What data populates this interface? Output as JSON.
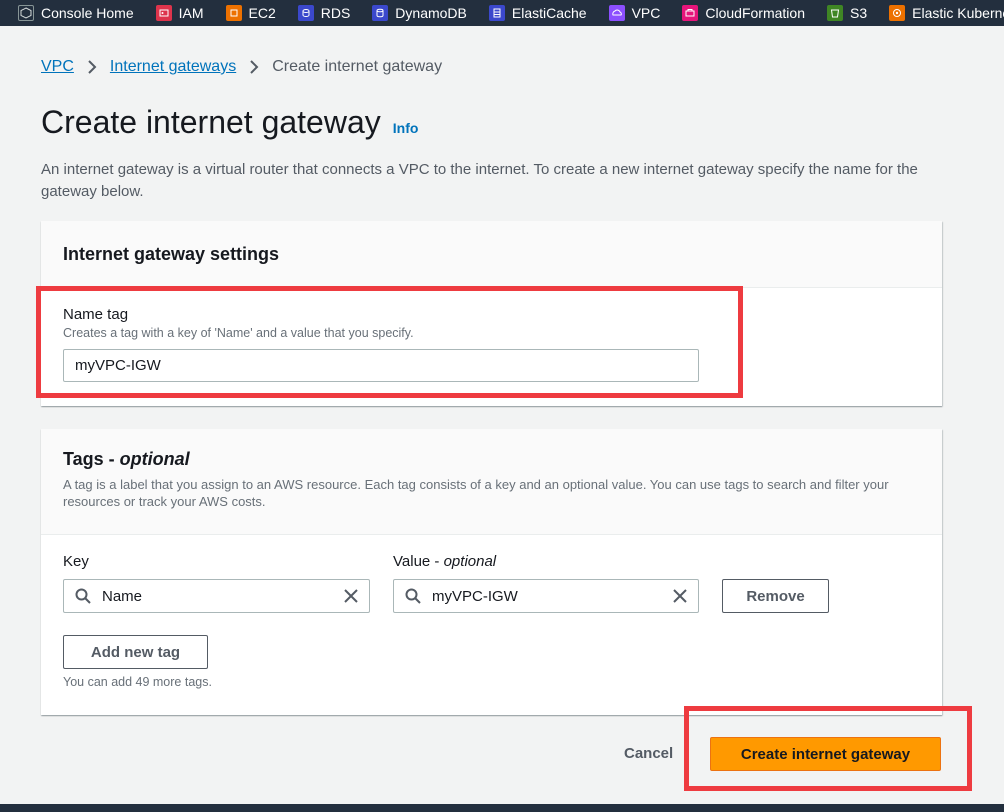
{
  "services": [
    {
      "label": "Console Home",
      "icon": "console-home-icon",
      "color": "#232f3e"
    },
    {
      "label": "IAM",
      "icon": "iam-icon",
      "color": "#dd344c"
    },
    {
      "label": "EC2",
      "icon": "ec2-icon",
      "color": "#ed7100"
    },
    {
      "label": "RDS",
      "icon": "rds-icon",
      "color": "#3b48cc"
    },
    {
      "label": "DynamoDB",
      "icon": "dynamodb-icon",
      "color": "#3b48cc"
    },
    {
      "label": "ElastiCache",
      "icon": "elasticache-icon",
      "color": "#3b48cc"
    },
    {
      "label": "VPC",
      "icon": "vpc-icon",
      "color": "#8c4fff"
    },
    {
      "label": "CloudFormation",
      "icon": "cloudformation-icon",
      "color": "#e7157b"
    },
    {
      "label": "S3",
      "icon": "s3-icon",
      "color": "#3f8624"
    },
    {
      "label": "Elastic Kubernetes Se",
      "icon": "eks-icon",
      "color": "#ed7100"
    }
  ],
  "breadcrumb": {
    "vpc": "VPC",
    "internet_gateways": "Internet gateways",
    "current": "Create internet gateway"
  },
  "page": {
    "title": "Create internet gateway",
    "info": "Info",
    "description": "An internet gateway is a virtual router that connects a VPC to the internet. To create a new internet gateway specify the name for the gateway below."
  },
  "settings": {
    "title": "Internet gateway settings",
    "name_tag_label": "Name tag",
    "name_tag_desc": "Creates a tag with a key of 'Name' and a value that you specify.",
    "name_tag_value": "myVPC-IGW"
  },
  "tags": {
    "title": "Tags - ",
    "title_optional": "optional",
    "description": "A tag is a label that you assign to an AWS resource. Each tag consists of a key and an optional value. You can use tags to search and filter your resources or track your AWS costs.",
    "key_label": "Key",
    "value_label": "Value - ",
    "value_optional": "optional",
    "key_value": "Name",
    "value_value": "myVPC-IGW",
    "remove": "Remove",
    "add_new_tag": "Add new tag",
    "remaining_hint": "You can add 49 more tags."
  },
  "actions": {
    "cancel": "Cancel",
    "create": "Create internet gateway"
  },
  "colors": {
    "highlight": "#ee3b40",
    "primary": "#ff9900",
    "link": "#0073bb",
    "nav": "#232f3e"
  }
}
